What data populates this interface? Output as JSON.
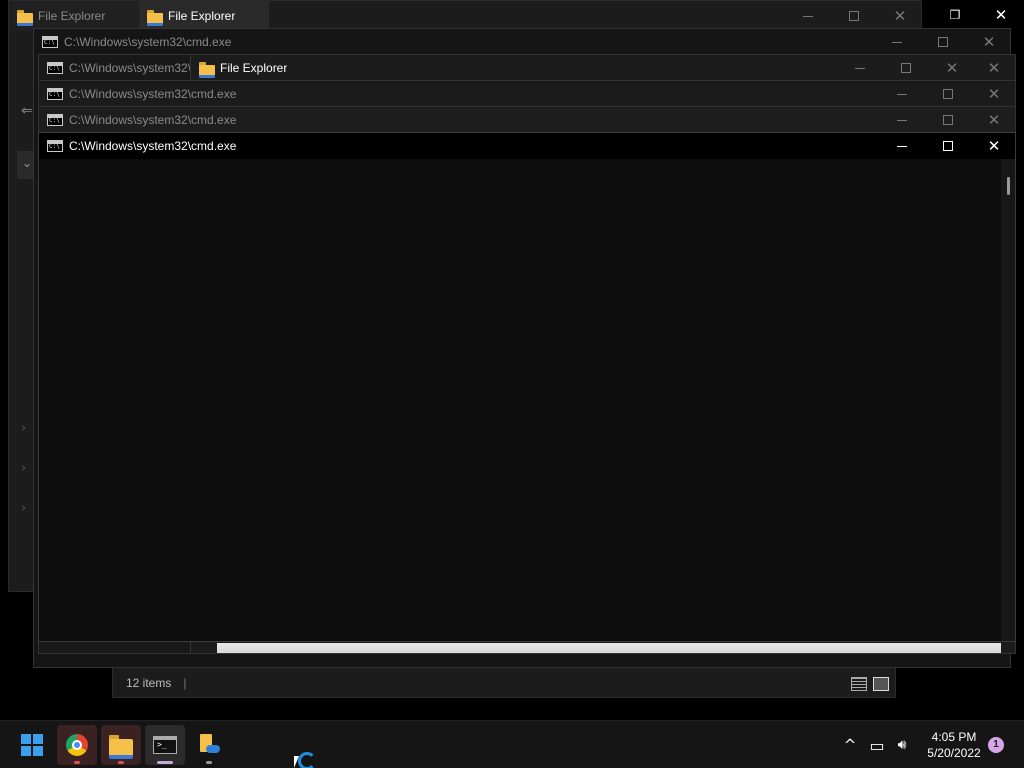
{
  "windows": {
    "explorer_back": {
      "tab1": "File Explorer",
      "tab2": "File Explorer"
    },
    "cmd1": {
      "title": "C:\\Windows\\system32\\cmd.exe"
    },
    "cmd2": {
      "title": "C:\\Windows\\system32\\"
    },
    "explorer_front": {
      "title": "File Explorer"
    },
    "cmd3": {
      "title": "C:\\Windows\\system32\\cmd.exe"
    },
    "cmd4": {
      "title": "C:\\Windows\\system32\\cmd.exe"
    },
    "cmd_active": {
      "title": "C:\\Windows\\system32\\cmd.exe"
    }
  },
  "explorer_status": {
    "items": "12 items",
    "separator": "|"
  },
  "glyphs": {
    "close": "✕",
    "restore": "❐",
    "back_arrow": "⇐",
    "chevron": "⌄",
    "chevron_right": "›",
    "tray_up": "^",
    "volume": "🔊︎",
    "display": "▭"
  },
  "taskbar": {
    "apps": [
      {
        "name": "start",
        "icon": "windows-logo-icon"
      },
      {
        "name": "chrome",
        "icon": "chrome-icon"
      },
      {
        "name": "file-explorer",
        "icon": "folder-icon"
      },
      {
        "name": "command-prompt",
        "icon": "terminal-icon"
      },
      {
        "name": "onedrive-file",
        "icon": "document-cloud-icon"
      }
    ],
    "clock": {
      "time": "4:05 PM",
      "date": "5/20/2022"
    },
    "notification_count": "1"
  },
  "colors": {
    "accent": "#1a8fe3",
    "console_bg": "#0c0c0c",
    "taskbar_bg": "#151515"
  }
}
